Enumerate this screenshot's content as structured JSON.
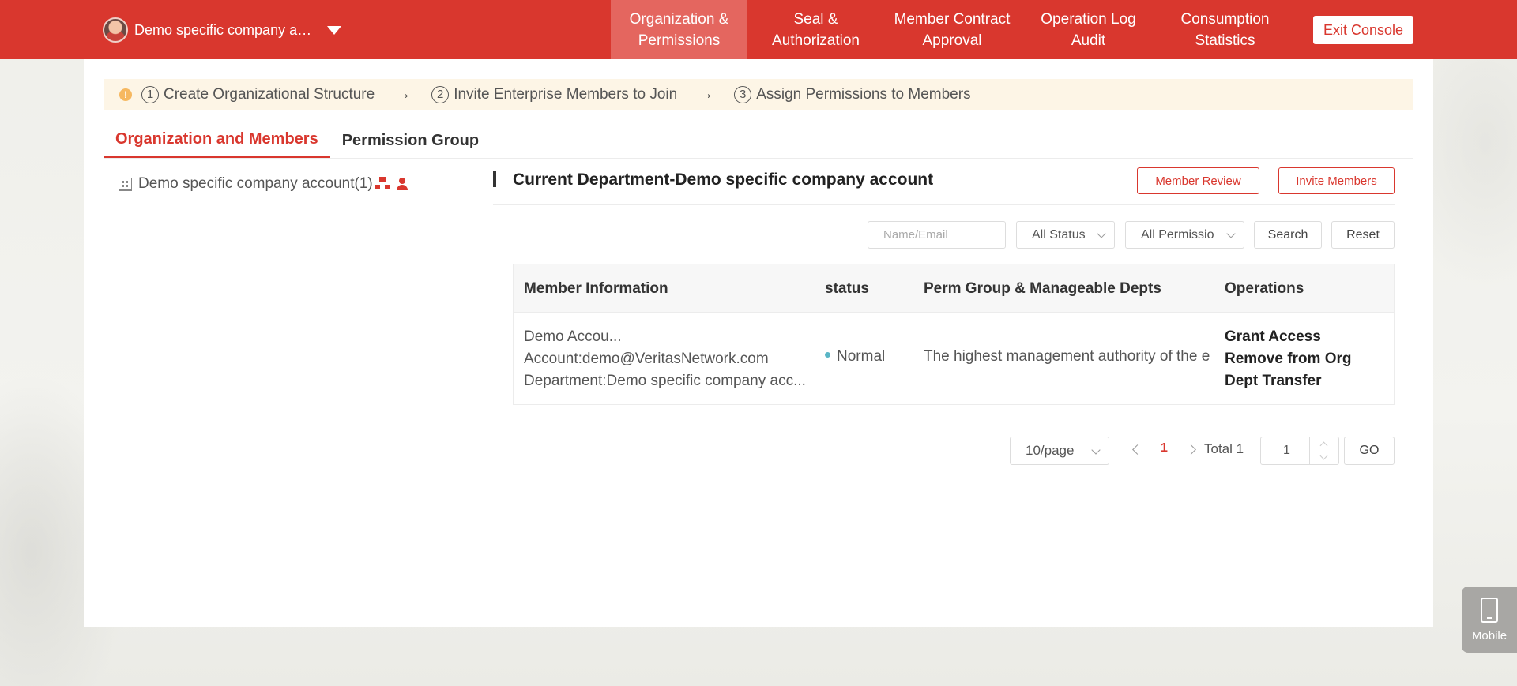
{
  "header": {
    "company_name": "Demo specific company a…",
    "nav": [
      {
        "label": "Organization & Permissions",
        "active": true
      },
      {
        "label": "Seal & Authorization"
      },
      {
        "label": "Member Contract Approval"
      },
      {
        "label": "Operation Log Audit"
      },
      {
        "label": "Consumption Statistics"
      }
    ],
    "exit_label": "Exit Console"
  },
  "steps": {
    "warn_icon": "!",
    "items": [
      {
        "num": "1",
        "label": "Create Organizational Structure"
      },
      {
        "num": "2",
        "label": "Invite Enterprise Members to Join"
      },
      {
        "num": "3",
        "label": "Assign Permissions to Members"
      }
    ],
    "arrow": "→"
  },
  "tabs": [
    {
      "label": "Organization and Members",
      "active": true
    },
    {
      "label": "Permission Group"
    }
  ],
  "tree": {
    "node_label": "Demo specific company account(1)"
  },
  "department": {
    "title": "Current Department-Demo specific company account",
    "member_review_label": "Member Review",
    "invite_members_label": "Invite Members"
  },
  "filters": {
    "name_placeholder": "Name/Email",
    "status_value": "All Status",
    "permission_value": "All Permissio",
    "search_label": "Search",
    "reset_label": "Reset"
  },
  "table": {
    "headers": [
      "Member Information",
      "status",
      "Perm Group & Manageable Depts",
      "Operations"
    ],
    "rows": [
      {
        "name": "Demo Accou...",
        "account": "Account:demo@VeritasNetwork.com",
        "department": "Department:Demo specific company acc...",
        "status": "Normal",
        "perm": "The highest management authority of the e",
        "ops": [
          "Grant Access",
          "Remove from Org",
          "Dept Transfer"
        ]
      }
    ]
  },
  "pagination": {
    "page_size": "10/page",
    "current_page": "1",
    "total": "Total 1",
    "jump_value": "1",
    "go_label": "GO"
  },
  "mobile": {
    "label": "Mobile"
  },
  "colors": {
    "brand_red": "#d9372e",
    "status_normal": "#5ab6c6"
  }
}
